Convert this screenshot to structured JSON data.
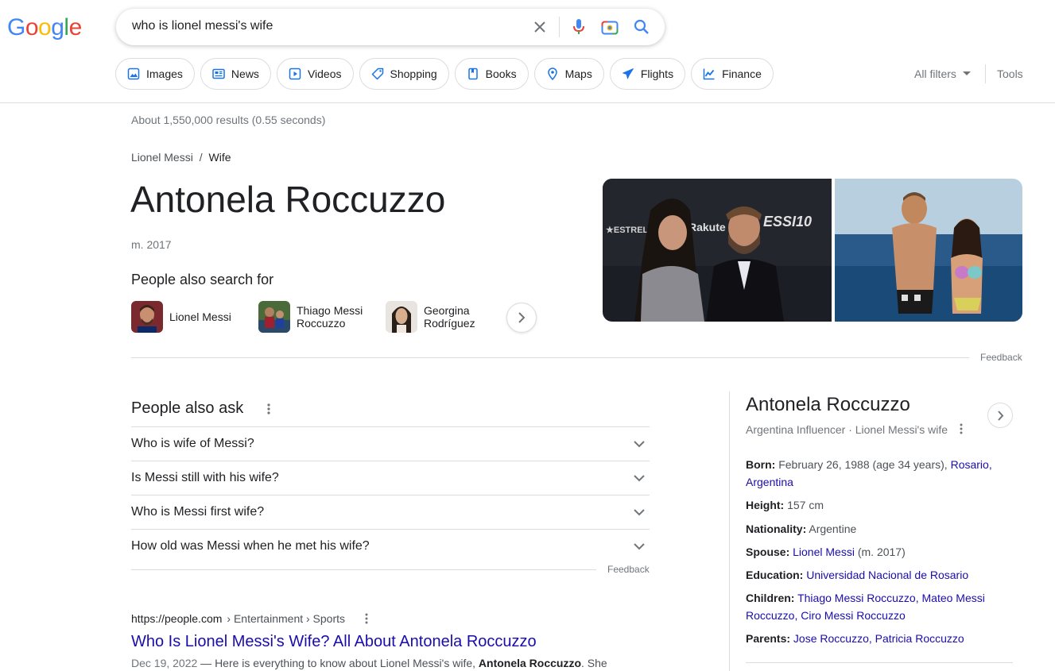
{
  "logo": {
    "g1": "G",
    "o1": "o",
    "o2": "o",
    "g2": "g",
    "l": "l",
    "e": "e"
  },
  "search": {
    "query": "who is lionel messi's wife"
  },
  "filters": [
    {
      "label": "Images",
      "icon": "image-icon"
    },
    {
      "label": "News",
      "icon": "news-icon"
    },
    {
      "label": "Videos",
      "icon": "video-icon"
    },
    {
      "label": "Shopping",
      "icon": "tag-icon"
    },
    {
      "label": "Books",
      "icon": "book-icon"
    },
    {
      "label": "Maps",
      "icon": "pin-icon"
    },
    {
      "label": "Flights",
      "icon": "plane-icon"
    },
    {
      "label": "Finance",
      "icon": "chart-icon"
    }
  ],
  "all_filters": "All filters",
  "tools": "Tools",
  "result_stats": "About 1,550,000 results (0.55 seconds)",
  "featured": {
    "breadcrumb_parent": "Lionel Messi",
    "breadcrumb_sep": "/",
    "breadcrumb_current": "Wife",
    "answer": "Antonela Roccuzzo",
    "married": "m. 2017",
    "people_also_search_title": "People also search for",
    "people": [
      {
        "line1": "Lionel Messi",
        "line2": ""
      },
      {
        "line1": "Thiago Messi",
        "line2": "Roccuzzo"
      },
      {
        "line1": "Georgina",
        "line2": "Rodríguez"
      }
    ],
    "feedback": "Feedback"
  },
  "paa": {
    "title": "People also ask",
    "questions": [
      "Who is wife of Messi?",
      "Is Messi still with his wife?",
      "Who is Messi first wife?",
      "How old was Messi when he met his wife?"
    ],
    "feedback": "Feedback"
  },
  "result": {
    "domain": "https://people.com",
    "path": " › Entertainment › Sports",
    "title": "Who Is Lionel Messi's Wife? All About Antonela Roccuzzo",
    "date": "Dec 19, 2022",
    "snippet_pre": " — Here is everything to know about Lionel Messi's wife, ",
    "snippet_bold": "Antonela Roccuzzo",
    "snippet_post": ". She"
  },
  "knowledge_panel": {
    "title": "Antonela Roccuzzo",
    "subtitle": "Argentina Influencer · Lionel Messi's wife",
    "born_label": "Born:",
    "born_value": "February 26, 1988 (age 34 years),",
    "born_link1": "Rosario,",
    "born_link2": "Argentina",
    "height_label": "Height:",
    "height_value": "157 cm",
    "nationality_label": "Nationality:",
    "nationality_value": "Argentine",
    "spouse_label": "Spouse:",
    "spouse_link": "Lionel Messi",
    "spouse_value": "(m. 2017)",
    "education_label": "Education:",
    "education_link": "Universidad Nacional de Rosario",
    "children_label": "Children:",
    "children_link1": "Thiago Messi Roccuzzo,",
    "children_link2": "Mateo Messi",
    "children_link3": "Roccuzzo,",
    "children_link4": "Ciro Messi Roccuzzo",
    "parents_label": "Parents:",
    "parents_link1": "Jose Roccuzzo,",
    "parents_link2": "Patricia Roccuzzo"
  },
  "colors": {
    "link": "#1a0dab",
    "accent_blue": "#4285f4"
  }
}
